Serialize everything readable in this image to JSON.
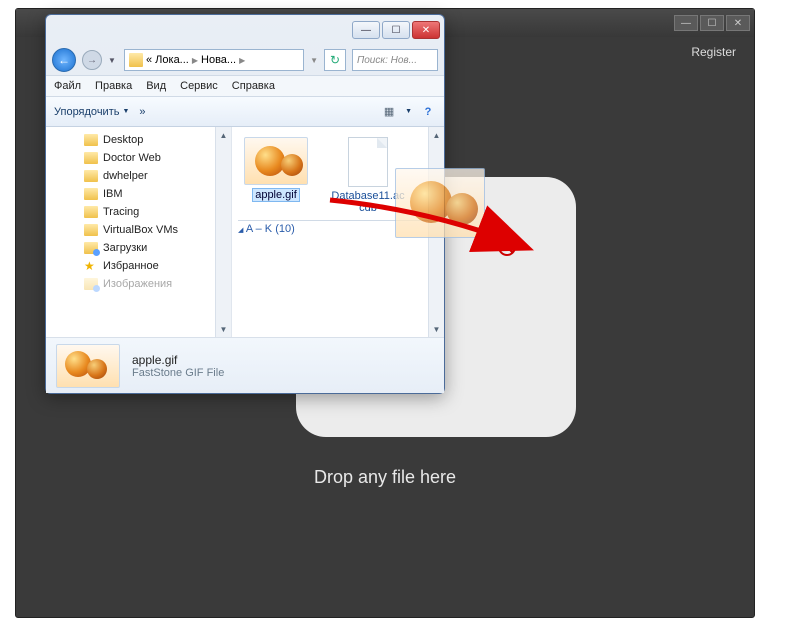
{
  "dark_app": {
    "register": "Register",
    "drop_text": "Drop any file here",
    "btn_min": "—",
    "btn_max": "☐",
    "btn_close": "✕"
  },
  "explorer": {
    "title_min": "—",
    "title_max": "☐",
    "title_close": "✕",
    "nav_back": "←",
    "nav_fwd": "→",
    "breadcrumb_1": "« Лока...",
    "breadcrumb_2": "Нова...",
    "refresh": "↻",
    "search_placeholder": "Поиск: Нов...",
    "menu": {
      "file": "Файл",
      "edit": "Правка",
      "view": "Вид",
      "service": "Сервис",
      "help": "Справка"
    },
    "toolbar": {
      "organize": "Упорядочить",
      "more": "»",
      "views": "▦",
      "help": "?"
    },
    "tree": [
      {
        "label": "Desktop",
        "icon": "folder"
      },
      {
        "label": "Doctor Web",
        "icon": "folder"
      },
      {
        "label": "dwhelper",
        "icon": "folder"
      },
      {
        "label": "IBM",
        "icon": "folder"
      },
      {
        "label": "Tracing",
        "icon": "folder"
      },
      {
        "label": "VirtualBox VMs",
        "icon": "folder"
      },
      {
        "label": "Загрузки",
        "icon": "folder-special"
      },
      {
        "label": "Избранное",
        "icon": "star"
      },
      {
        "label": "Изображения",
        "icon": "folder-special"
      }
    ],
    "files": {
      "item1_label": "apple.gif",
      "item2_label": "Database11.accdb",
      "group_label": "A – K (10)"
    },
    "details": {
      "name": "apple.gif",
      "type": "FastStone GIF File"
    }
  }
}
